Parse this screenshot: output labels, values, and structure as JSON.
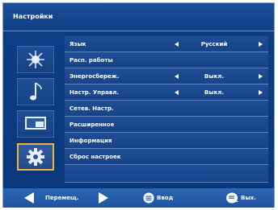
{
  "header": {
    "title": "Настройки"
  },
  "sidebar": {
    "items": [
      {
        "icon": "brightness-icon"
      },
      {
        "icon": "music-note-icon"
      },
      {
        "icon": "screen-icon"
      },
      {
        "icon": "gear-icon",
        "selected": true
      }
    ]
  },
  "menu": {
    "items": [
      {
        "label": "Язык",
        "value": "Русский"
      },
      {
        "label": "Расп. работы"
      },
      {
        "label": "Энергосбереж.",
        "value": "Выкл."
      },
      {
        "label": "Настр. Управл.",
        "value": "Выкл."
      },
      {
        "label": "Сетев. Настр."
      },
      {
        "label": "Расширенное"
      },
      {
        "label": "Информация"
      },
      {
        "label": "Сброс настроек"
      },
      {
        "label": ""
      }
    ]
  },
  "footer": {
    "move_label": "Перемещ.",
    "enter_label": "Ввод",
    "exit_label": "Вых."
  },
  "colors": {
    "accent": "#f0b43a",
    "background": "#0c3f86"
  }
}
